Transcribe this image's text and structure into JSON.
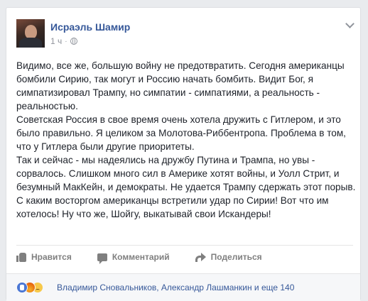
{
  "post": {
    "author": "Исраэль Шамир",
    "time": "1 ч",
    "separator": "·",
    "paragraphs": [
      "Видимо, все же, большую войну не предотвратить. Сегодня американцы бомбили Сирию, так могут и Россию начать бомбить. Видит Бог, я симпатизировал Трампу, но симпатии - симпатиями, а реальность - реальностью.",
      "Советская Россия в свое время очень хотела дружить с Гитлером, и это было правильно. Я целиком за Молотова-Риббентропа. Проблема в том, что у Гитлера были другие приоритеты.",
      "Так и сейчас - мы надеялись на дружбу Путина и Трампа, но увы - сорвалось. Слишком много сил в Америке хотят войны, и Уолл Стрит, и безумный МакКейн, и демократы. Не удается Трампу сдержать этот порыв.",
      "С каким восторгом американцы встретили удар по Сирии! Вот что им хотелось! Ну что же, Шойгу, выкатывай свои Искандеры!"
    ]
  },
  "actions": {
    "like": "Нравится",
    "comment": "Комментарий",
    "share": "Поделиться"
  },
  "reactions": {
    "summary": "Владимир Сновальников, Александр Лашманкин и еще 140",
    "types": [
      "like-icon",
      "angry-icon",
      "sad-icon"
    ]
  },
  "colors": {
    "link": "#365899",
    "text": "#1d2129",
    "meta": "#90949c",
    "background": "#e9ebee"
  }
}
